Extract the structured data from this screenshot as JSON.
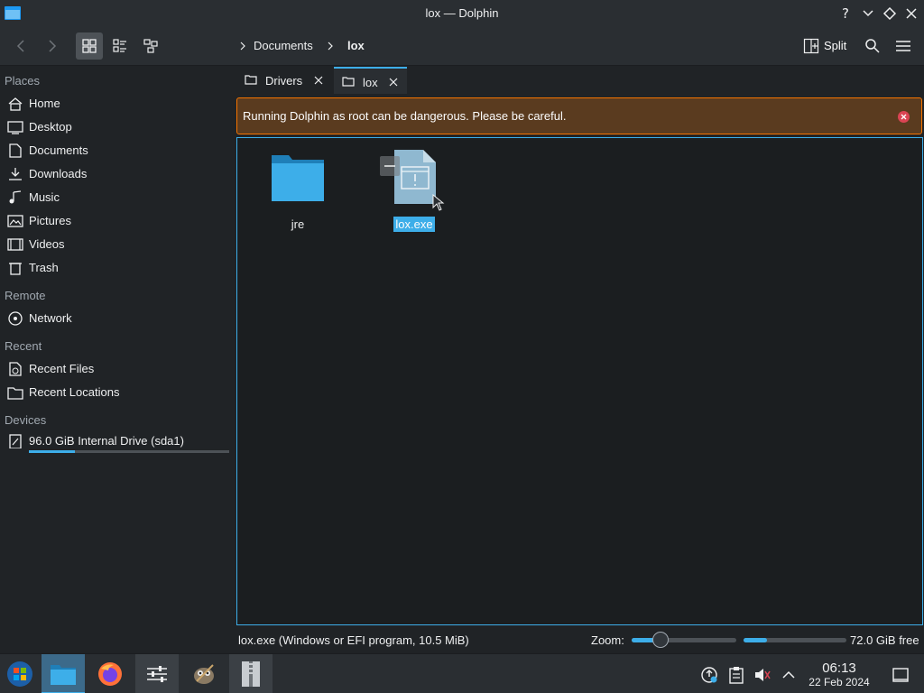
{
  "window": {
    "title": "lox — Dolphin"
  },
  "toolbar": {
    "breadcrumbs": [
      "Documents",
      "lox"
    ],
    "split_label": "Split"
  },
  "sidebar": {
    "sections": {
      "places": "Places",
      "remote": "Remote",
      "recent": "Recent",
      "devices": "Devices"
    },
    "places": [
      {
        "label": "Home",
        "icon": "home-icon"
      },
      {
        "label": "Desktop",
        "icon": "desktop-icon"
      },
      {
        "label": "Documents",
        "icon": "documents-icon"
      },
      {
        "label": "Downloads",
        "icon": "downloads-icon"
      },
      {
        "label": "Music",
        "icon": "music-icon"
      },
      {
        "label": "Pictures",
        "icon": "pictures-icon"
      },
      {
        "label": "Videos",
        "icon": "videos-icon"
      },
      {
        "label": "Trash",
        "icon": "trash-icon"
      }
    ],
    "remote": [
      {
        "label": "Network",
        "icon": "network-icon"
      }
    ],
    "recent": [
      {
        "label": "Recent Files",
        "icon": "recent-files-icon"
      },
      {
        "label": "Recent Locations",
        "icon": "recent-locations-icon"
      }
    ],
    "devices": [
      {
        "label": "96.0 GiB Internal Drive (sda1)",
        "icon": "drive-icon",
        "usage_fraction": 0.23
      }
    ]
  },
  "tabs": [
    {
      "label": "Drivers",
      "active": false
    },
    {
      "label": "lox",
      "active": true
    }
  ],
  "warning": {
    "message": "Running Dolphin as root can be dangerous. Please be careful."
  },
  "files": [
    {
      "name": "jre",
      "type": "folder",
      "selected": false
    },
    {
      "name": "lox.exe",
      "type": "executable",
      "selected": true
    }
  ],
  "statusbar": {
    "info": "lox.exe (Windows or EFI program, 10.5 MiB)",
    "zoom_label": "Zoom:",
    "zoom_fraction": 0.25,
    "free_space": "72.0 GiB free",
    "used_fraction": 0.23
  },
  "taskbar": {
    "time": "06:13",
    "date": "22 Feb 2024"
  },
  "colors": {
    "accent": "#3daee9",
    "warning_border": "#f67400",
    "warning_bg": "#5a3b1f",
    "close_red": "#da4453"
  }
}
